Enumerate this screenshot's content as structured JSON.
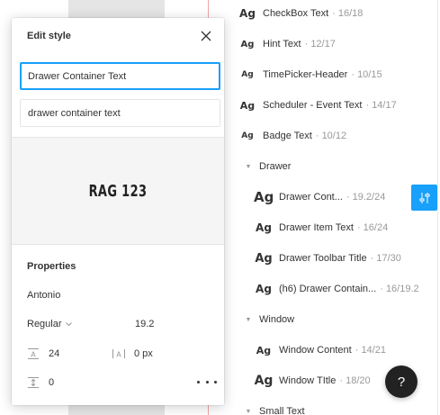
{
  "dialog": {
    "title": "Edit style",
    "name_value": "Drawer Container Text",
    "description_value": "drawer container text",
    "preview_text": "RAG 123",
    "properties_title": "Properties",
    "font_family": "Antonio",
    "font_weight": "Regular",
    "font_size": "19.2",
    "line_height": "24",
    "letter_spacing": "0 px",
    "paragraph_spacing": "0"
  },
  "style_list": {
    "ag_glyph": "Ag",
    "items_top": [
      {
        "name": "CheckBox Text",
        "meta": "· 16/18"
      },
      {
        "name": "Hint Text",
        "meta": "· 12/17"
      },
      {
        "name": "TimePicker-Header",
        "meta": "· 10/15"
      },
      {
        "name": "Scheduler - Event Text",
        "meta": "· 14/17"
      },
      {
        "name": "Badge Text",
        "meta": "· 10/12"
      }
    ],
    "groups": [
      {
        "name": "Drawer"
      },
      {
        "name": "Window"
      },
      {
        "name": "Small Text"
      }
    ],
    "drawer_items": [
      {
        "name": "Drawer Cont...",
        "meta": "· 19.2/24"
      },
      {
        "name": "Drawer Item Text",
        "meta": "· 16/24"
      },
      {
        "name": "Drawer Toolbar Title",
        "meta": "· 17/30"
      },
      {
        "name": "(h6) Drawer Contain...",
        "meta": "· 16/19.2"
      }
    ],
    "window_items": [
      {
        "name": "Window Content",
        "meta": "· 14/21"
      },
      {
        "name": "Window TItle",
        "meta": "· 18/20"
      }
    ]
  },
  "help_label": "?",
  "colors": {
    "accent": "#18a0fb",
    "help_bg": "#222222"
  }
}
